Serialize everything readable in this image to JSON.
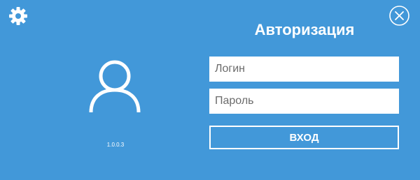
{
  "window": {
    "title": "Авторизация",
    "version": "1.0.0.3",
    "background_color": "#4298d9"
  },
  "toolbar": {
    "settings_icon": "gear-icon",
    "close_icon": "close-circle-icon"
  },
  "avatar": {
    "icon": "user-icon"
  },
  "form": {
    "login": {
      "placeholder": "Логин",
      "value": ""
    },
    "password": {
      "placeholder": "Пароль",
      "value": ""
    },
    "submit_label": "ВХОД"
  }
}
